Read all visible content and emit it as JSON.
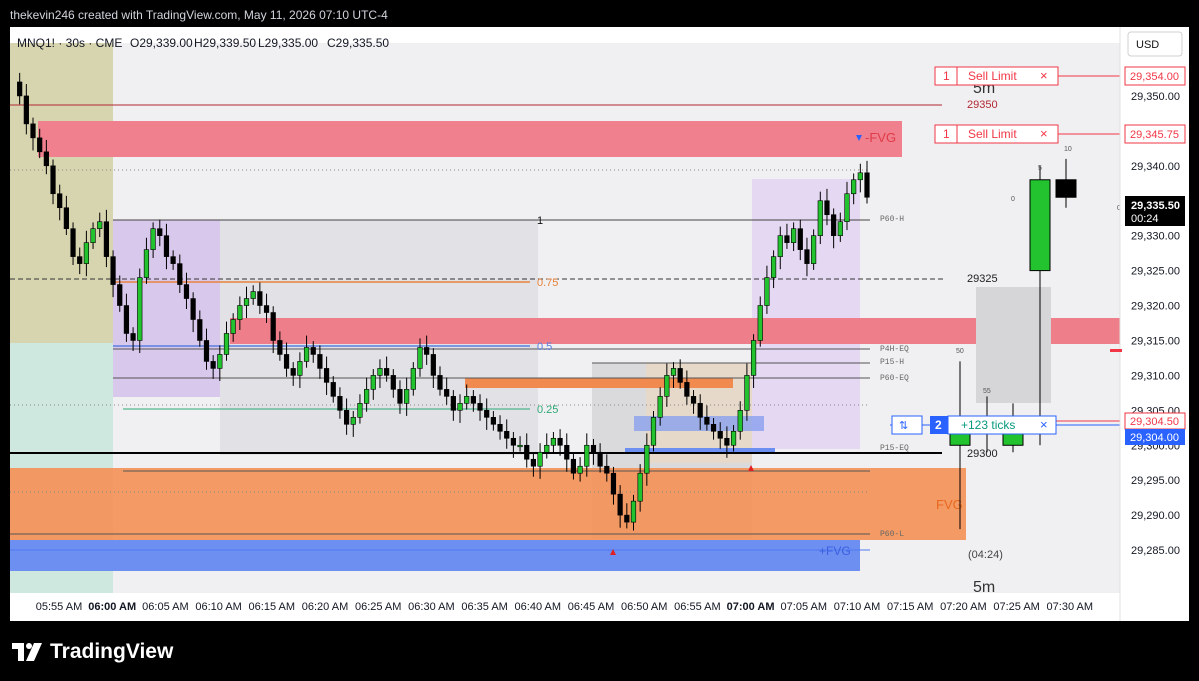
{
  "header": {
    "attribution": "thekevin246 created with TradingView.com, May 11, 2026 07:10 UTC-4"
  },
  "footer": {
    "brand": "TradingView"
  },
  "currency": "USD",
  "legend": {
    "symbol": "MNQ1! · 30s · CME",
    "open": "O29,339.00",
    "high": "H29,339.50",
    "low": "L29,335.00",
    "close": "C29,335.50"
  },
  "orders": [
    {
      "qty": "1",
      "label": "Sell Limit",
      "close": "×",
      "price": "29,354.00"
    },
    {
      "qty": "1",
      "label": "Sell Limit",
      "close": "×",
      "price": "29,345.75"
    }
  ],
  "position": {
    "side_icon": "⇅",
    "qty": "2",
    "pnl": "+123 ticks",
    "close": "×",
    "entry_price": "29,304.50",
    "last_price": "29,304.00"
  },
  "last_price": {
    "price": "29,335.50",
    "countdown": "00:24"
  },
  "chart_labels": {
    "fvg_bear": "-FVG",
    "fvg_bull": "+FVG",
    "fvg_bull_5m": "FVG",
    "fib_1": "1",
    "fib_075": "0.75",
    "fib_05": "0.5",
    "fib_025": "0.25",
    "level_29350": "29350",
    "level_29325": "29325",
    "level_29300": "29300",
    "p60h": "P60-H",
    "p4heq": "P4H-EQ",
    "p15h": "P15-H",
    "p60eq": "P60-EQ",
    "p15eq": "P15-EQ",
    "p60l": "P60-L",
    "tf_top": "5m",
    "tf_bottom": "5m",
    "countdown_5m": "(04:24)",
    "vol_0a": "0",
    "vol_5": "5",
    "vol_10": "10",
    "vol_0b": "0",
    "vol_50": "50",
    "vol_55": "55"
  },
  "chart_data": {
    "type": "candlestick",
    "title": "MNQ1! · 30s · CME",
    "y_axis": {
      "min": 29280,
      "max": 29355,
      "ticks": [
        29285,
        29290,
        29295,
        29300,
        29305,
        29310,
        29315,
        29320,
        29325,
        29330,
        29335,
        29340,
        29345,
        29350,
        29355
      ],
      "tick_labels": [
        "29,285.00",
        "29,290.00",
        "29,295.00",
        "29,300.00",
        "29,305.00",
        "29,310.00",
        "29,315.00",
        "29,320.00",
        "29,325.00",
        "29,330.00",
        "29,335.00",
        "29,340.00",
        "29,345.00",
        "29,350.00",
        "29,355.00"
      ]
    },
    "x_axis": {
      "tick_labels": [
        "05:55 AM",
        "06:00 AM",
        "06:05 AM",
        "06:10 AM",
        "06:15 AM",
        "06:20 AM",
        "06:25 AM",
        "06:30 AM",
        "06:35 AM",
        "06:40 AM",
        "06:45 AM",
        "06:50 AM",
        "06:55 AM",
        "07:00 AM",
        "07:05 AM",
        "07:10 AM",
        "07:15 AM",
        "07:20 AM",
        "07:25 AM",
        "07:30 AM"
      ],
      "bold": [
        "06:00 AM",
        "07:00 AM"
      ]
    },
    "series": [
      {
        "name": "30s",
        "close": [
          29352,
          29350,
          29346,
          29344,
          29342,
          29340,
          29336,
          29334,
          29331,
          29327,
          29326,
          29329,
          29331,
          29332,
          29327,
          29323,
          29320,
          29316,
          29315,
          29324,
          29328,
          29331,
          29330,
          29327,
          29326,
          29323,
          29321,
          29318,
          29315,
          29312,
          29311,
          29313,
          29316,
          29318,
          29320,
          29321,
          29322,
          29320,
          29319,
          29315,
          29313,
          29311,
          29310,
          29312,
          29314,
          29313,
          29311,
          29309,
          29307,
          29305,
          29303,
          29304,
          29306,
          29308,
          29310,
          29311,
          29310,
          29308,
          29306,
          29308,
          29311,
          29314,
          29313,
          29310,
          29308,
          29307,
          29305,
          29306,
          29307,
          29306,
          29305,
          29304,
          29303,
          29302,
          29301,
          29300,
          29300,
          29298,
          29297,
          29299,
          29300,
          29301,
          29300,
          29298,
          29296,
          29297,
          29300,
          29299,
          29297,
          29296,
          29293,
          29290,
          29289,
          29292,
          29296,
          29300,
          29304,
          29307,
          29310,
          29311,
          29309,
          29307,
          29306,
          29304,
          29303,
          29302,
          29301,
          29300,
          29302,
          29305,
          29310,
          29315,
          29320,
          29324,
          29327,
          29330,
          29329,
          29331,
          29328,
          29326,
          29330,
          29335,
          29333,
          29330,
          29332,
          29336,
          29338,
          29339,
          29335.5
        ]
      },
      {
        "name": "5m",
        "open": [
          29300,
          29304,
          29300,
          29325,
          29338
        ],
        "high": [
          29312,
          29307,
          29306,
          29340,
          29341
        ],
        "low": [
          29288,
          29299,
          29299,
          29300,
          29334
        ],
        "close": [
          29304,
          29302,
          29304,
          29338,
          29335.5
        ],
        "volume": [
          50,
          55,
          0,
          5,
          10
        ]
      }
    ],
    "zones": [
      {
        "label": "-FVG",
        "from": 29343,
        "to": 29348
      },
      {
        "label": "+FVG",
        "from": 29284,
        "to": 29288
      },
      {
        "label": "FVG",
        "from": 29288,
        "to": 29297
      },
      {
        "label": "-FVG",
        "from": 29315,
        "to": 29319
      }
    ],
    "fib_levels": [
      {
        "label": "1",
        "value": 29330
      },
      {
        "label": "0.75",
        "value": 29322.5
      },
      {
        "label": "0.5",
        "value": 29315
      },
      {
        "label": "0.25",
        "value": 29307.5
      }
    ],
    "levels": [
      {
        "label": "P60-H",
        "value": 29330
      },
      {
        "label": "P4H-EQ",
        "value": 29315
      },
      {
        "label": "P15-H",
        "value": 29313
      },
      {
        "label": "P60-EQ",
        "value": 29311
      },
      {
        "label": "P15-EQ",
        "value": 29300
      },
      {
        "label": "P60-L",
        "value": 29289
      }
    ],
    "price_lines": [
      {
        "label": "29350",
        "value": 29350
      },
      {
        "label": "29325",
        "value": 29325
      },
      {
        "label": "29300",
        "value": 29300
      }
    ],
    "colors": {
      "up": "#22c32e",
      "down": "#000000",
      "sell": "#f23645",
      "bull_fvg": "#4f79f0",
      "bear_fvg": "#f07080",
      "fvg_5m": "#f28c4e",
      "last": "#000000",
      "position": "#2962ff"
    }
  }
}
